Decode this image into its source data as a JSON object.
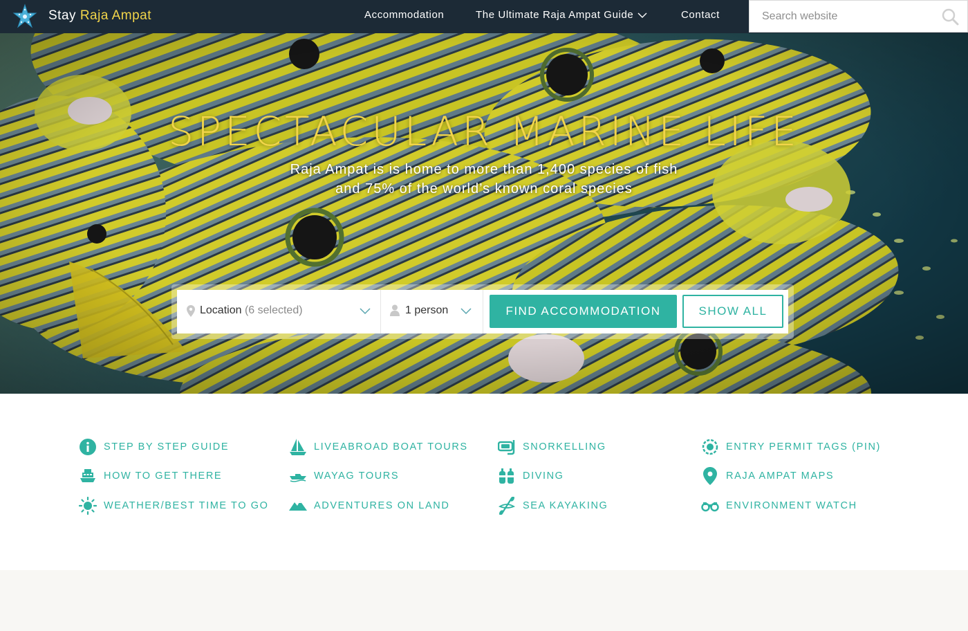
{
  "nav": {
    "brand_first": "Stay",
    "brand_second": "Raja Ampat",
    "links": [
      {
        "label": "Accommodation"
      },
      {
        "label": "The Ultimate Raja Ampat Guide"
      },
      {
        "label": "Contact"
      }
    ],
    "search_placeholder": "Search website"
  },
  "hero": {
    "headline": "SPECTACULAR MARINE LIFE",
    "sub_line1": "Raja Ampat is is home to more than 1,400 species of fish",
    "sub_line2": "and 75% of the world’s known coral species",
    "location_label": "Location",
    "location_selected": "(6 selected)",
    "guests_value": "1 person",
    "find_button": "FIND ACCOMMODATION",
    "show_all_button": "SHOW ALL"
  },
  "guide_links": {
    "col1": [
      {
        "label": "STEP BY STEP GUIDE",
        "icon": "info-icon"
      },
      {
        "label": "HOW TO GET THERE",
        "icon": "ferry-icon"
      },
      {
        "label": "WEATHER/BEST TIME TO GO",
        "icon": "sun-icon"
      }
    ],
    "col2": [
      {
        "label": "LIVEABROAD BOAT TOURS",
        "icon": "sailboat-icon"
      },
      {
        "label": "WAYAG TOURS",
        "icon": "speedboat-icon"
      },
      {
        "label": "ADVENTURES ON LAND",
        "icon": "mountain-icon"
      }
    ],
    "col3": [
      {
        "label": "SNORKELLING",
        "icon": "snorkel-mask-icon"
      },
      {
        "label": "DIVING",
        "icon": "dive-tanks-icon"
      },
      {
        "label": "SEA KAYAKING",
        "icon": "kayak-paddle-icon"
      }
    ],
    "col4": [
      {
        "label": "ENTRY PERMIT TAGS (PIN)",
        "icon": "permit-tag-icon"
      },
      {
        "label": "RAJA AMPAT MAPS",
        "icon": "map-pin-icon"
      },
      {
        "label": "ENVIRONMENT WATCH",
        "icon": "binoculars-icon"
      }
    ]
  },
  "colors": {
    "nav_bg": "#1c2a36",
    "accent_yellow": "#f2d54a",
    "teal": "#2fb3a2",
    "footer_bg": "#f8f7f4"
  }
}
